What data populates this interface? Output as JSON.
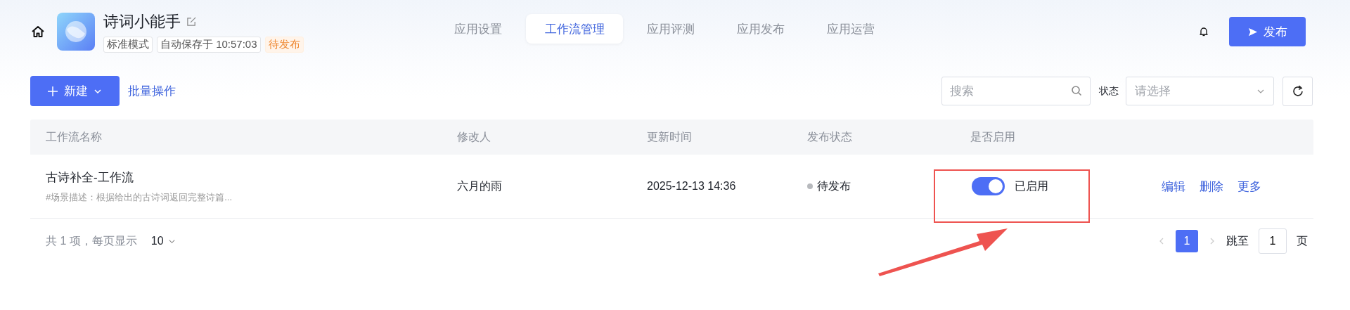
{
  "app": {
    "name": "诗词小能手",
    "tags": [
      {
        "label": "标准模式",
        "kind": "plain"
      },
      {
        "label": "自动保存于 10:57:03",
        "kind": "plain"
      },
      {
        "label": "待发布",
        "kind": "warning"
      }
    ]
  },
  "tabs": [
    {
      "label": "应用设置",
      "selected": false
    },
    {
      "label": "工作流管理",
      "selected": true
    },
    {
      "label": "应用评测",
      "selected": false
    },
    {
      "label": "应用发布",
      "selected": false
    },
    {
      "label": "应用运营",
      "selected": false
    }
  ],
  "publish_button": "发布",
  "toolbar": {
    "new_button": "新建",
    "batch_link": "批量操作",
    "search": {
      "placeholder": "搜索"
    },
    "status_filter": {
      "label": "状态",
      "placeholder": "请选择"
    }
  },
  "table": {
    "columns": [
      "工作流名称",
      "修改人",
      "更新时间",
      "发布状态",
      "是否启用"
    ],
    "rows": [
      {
        "name": "古诗补全-工作流",
        "description": "#场景描述：根据给出的古诗词返回完整诗篇...",
        "modifier": "六月的雨",
        "updated": "2025-12-13 14:36",
        "status": "待发布",
        "enabled": true,
        "enabled_label": "已启用",
        "highlighted": true,
        "actions": [
          "编辑",
          "删除",
          "更多"
        ]
      }
    ]
  },
  "pagination": {
    "summary": "共 1 项，每页显示",
    "page_size": "10",
    "pages": [
      {
        "label": "1",
        "selected": true
      }
    ],
    "jump_label": "跳至",
    "jump_value": "1",
    "page_suffix": "页"
  }
}
